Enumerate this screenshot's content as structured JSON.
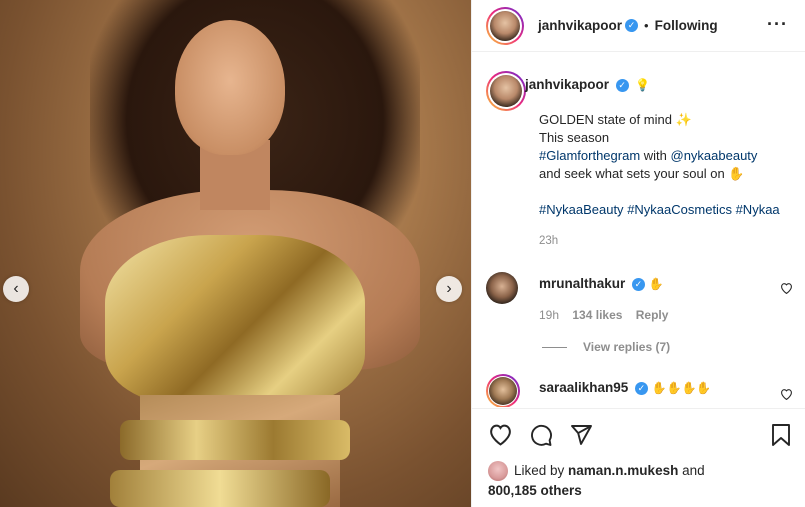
{
  "photo": {
    "prev_icon": "chevron-left-icon",
    "next_icon": "chevron-right-icon"
  },
  "header": {
    "username": "janhvikapoor",
    "separator": "•",
    "follow_status": "Following",
    "more_icon": "more-icon"
  },
  "caption": {
    "username": "janhvikapoor",
    "bulb_emoji": "💡",
    "line1": "GOLDEN state of mind ✨",
    "line2": "This season",
    "tag_glam": "#Glamforthegram",
    "with_text": " with ",
    "mention": "@nykaabeauty",
    "line4": "and seek what sets your soul on ✋",
    "tag1": "#NykaaBeauty",
    "tag2": "#NykaaCosmetics",
    "tag3": "#Nykaa",
    "time": "23h"
  },
  "comments": [
    {
      "username": "mrunalthakur",
      "text": "✋",
      "time": "19h",
      "likes": "134 likes",
      "reply": "Reply"
    },
    {
      "username": "saraalikhan95",
      "text": "✋✋✋✋"
    }
  ],
  "view_replies": "View replies (7)",
  "likes": {
    "prefix": "Liked by ",
    "user": "naman.n.mukesh",
    "and": " and",
    "count": "800,185 others"
  }
}
